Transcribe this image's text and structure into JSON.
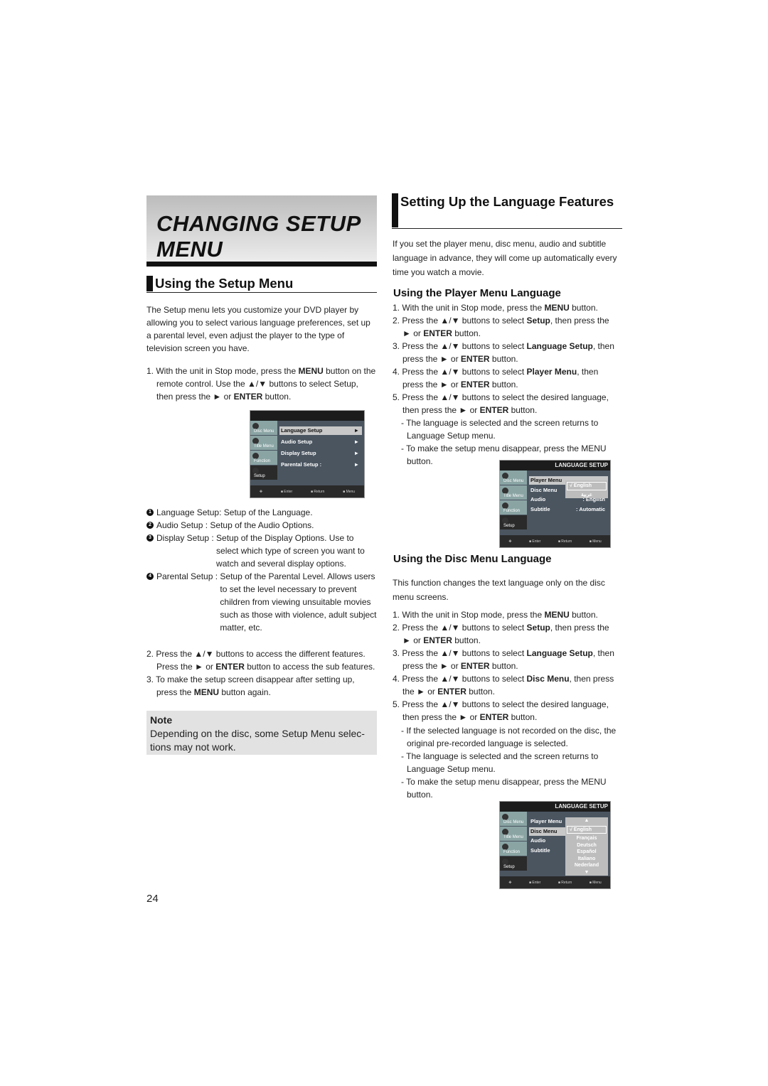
{
  "header": {
    "title_line1": "CHANGING SETUP",
    "title_line2": "MENU"
  },
  "left": {
    "heading": "Using the Setup Menu",
    "intro": "The Setup menu lets you customize your DVD player by allowing you to select various language preferences, set up a parental level, even adjust the player to the type of television screen you have.",
    "step1": [
      {
        "t": "1. With the unit in Stop mode, press the "
      },
      {
        "t": "MENU",
        "b": true
      },
      {
        "t": " button on the remote control.  Use the ▲/▼ buttons to select Setup, then press the ► or "
      },
      {
        "t": "ENTER",
        "b": true
      },
      {
        "t": " button."
      }
    ],
    "legend": [
      {
        "n": "1",
        "label": "Language Setup: Setup of the Language."
      },
      {
        "n": "2",
        "label": "Audio Setup : Setup of the Audio Options."
      },
      {
        "n": "3",
        "label": "Display Setup : Setup of the Display Options. Use to select which type of screen you want to watch and several display options."
      },
      {
        "n": "4",
        "label": "Parental Setup : Setup of the Parental Level. Allows users to set the level necessary to prevent children from viewing unsuitable movies such as those with violence, adult subject matter, etc."
      }
    ],
    "steps2": [
      [
        {
          "t": "2. Press the ▲/▼ buttons to access the different  features. Press the ► or "
        },
        {
          "t": "ENTER",
          "b": true
        },
        {
          "t": " button to access the sub features."
        }
      ],
      [
        {
          "t": "3. To make the setup screen disappear after setting up, press the "
        },
        {
          "t": "MENU",
          "b": true
        },
        {
          "t": " button again."
        }
      ]
    ],
    "note": {
      "title": "Note",
      "text": "Depending on the disc, some Setup Menu selec- tions may not work."
    }
  },
  "right": {
    "heading": "Setting Up the Language Features",
    "intro": "If you set the player menu, disc menu, audio and subtitle language in advance, they will come up automatically every time you watch a movie.",
    "player": {
      "title": "Using the Player Menu Language",
      "steps": [
        [
          {
            "t": "1. With the unit in Stop mode, press the "
          },
          {
            "t": "MENU",
            "b": true
          },
          {
            "t": " button."
          }
        ],
        [
          {
            "t": "2. Press the ▲/▼ buttons to select "
          },
          {
            "t": "Setup",
            "b": true
          },
          {
            "t": ", then press the ► or "
          },
          {
            "t": "ENTER",
            "b": true
          },
          {
            "t": " button."
          }
        ],
        [
          {
            "t": "3. Press the ▲/▼ buttons to select "
          },
          {
            "t": "Language Setup",
            "b": true
          },
          {
            "t": ", then press the ► or "
          },
          {
            "t": "ENTER",
            "b": true
          },
          {
            "t": " button."
          }
        ],
        [
          {
            "t": "4. Press the ▲/▼ buttons to select "
          },
          {
            "t": "Player Menu",
            "b": true
          },
          {
            "t": ", then press the ► or "
          },
          {
            "t": "ENTER",
            "b": true
          },
          {
            "t": " button."
          }
        ],
        [
          {
            "t": "5. Press the ▲/▼ buttons to select the desired language, then press the ► or "
          },
          {
            "t": "ENTER",
            "b": true
          },
          {
            "t": " button."
          }
        ]
      ],
      "notes": [
        "- The language is selected and the screen returns to Language Setup menu.",
        "- To make the setup menu disappear, press the MENU button."
      ]
    },
    "disc": {
      "title": "Using the Disc Menu Language",
      "intro": "This function changes the text language only on the disc menu screens.",
      "steps": [
        [
          {
            "t": "1. With the unit in Stop mode, press the "
          },
          {
            "t": "MENU",
            "b": true
          },
          {
            "t": " button."
          }
        ],
        [
          {
            "t": "2. Press the ▲/▼ buttons to select "
          },
          {
            "t": "Setup",
            "b": true
          },
          {
            "t": ", then press the ► or "
          },
          {
            "t": "ENTER",
            "b": true
          },
          {
            "t": " button."
          }
        ],
        [
          {
            "t": "3. Press the ▲/▼ buttons to select "
          },
          {
            "t": "Language Setup",
            "b": true
          },
          {
            "t": ", then press the ► or "
          },
          {
            "t": "ENTER",
            "b": true
          },
          {
            "t": " button."
          }
        ],
        [
          {
            "t": "4. Press the  ▲/▼ buttons to select "
          },
          {
            "t": "Disc Menu",
            "b": true
          },
          {
            "t": ", then press the ► or "
          },
          {
            "t": "ENTER",
            "b": true
          },
          {
            "t": "  button."
          }
        ],
        [
          {
            "t": "5. Press the ▲/▼ buttons to select the desired     language, then press the ► or "
          },
          {
            "t": "ENTER",
            "b": true
          },
          {
            "t": " button."
          }
        ]
      ],
      "notes": [
        "- If the selected language is not recorded on  the disc, the original pre-recorded language is selected.",
        "- The language is selected and the screen returns to Language Setup menu.",
        "- To make the setup menu disappear, press the MENU button."
      ]
    }
  },
  "screens": [
    {
      "title": "",
      "tabs": [
        "Disc Menu",
        "Title Menu",
        "Function",
        "Setup"
      ],
      "rows": [
        {
          "l": "Language Setup",
          "r": "►",
          "sel": true
        },
        {
          "l": "Audio Setup",
          "r": "►"
        },
        {
          "l": "Display Setup",
          "r": "►"
        },
        {
          "l": "Parental Setup :",
          "r": "►"
        }
      ],
      "footer": [
        "Enter",
        "Return",
        "Menu"
      ]
    },
    {
      "title": "LANGUAGE SETUP",
      "tabs": [
        "Disc Menu",
        "Title Menu",
        "Function",
        "Setup"
      ],
      "rows": [
        {
          "l": "Player Menu",
          "sel": true
        },
        {
          "l": "Disc Menu"
        },
        {
          "l": "Audio",
          "r": ": English"
        },
        {
          "l": "Subtitle",
          "r": ": Automatic"
        }
      ],
      "popup": [
        "√  English",
        "عربية"
      ],
      "footer": [
        "Enter",
        "Return",
        "Menu"
      ]
    },
    {
      "title": "LANGUAGE SETUP",
      "tabs": [
        "Disc Menu",
        "Title Menu",
        "Function",
        "Setup"
      ],
      "rows": [
        {
          "l": "Player Menu"
        },
        {
          "l": "Disc Menu",
          "sel": true
        },
        {
          "l": "Audio"
        },
        {
          "l": "Subtitle"
        }
      ],
      "popup": [
        "▲",
        "√ English",
        "Français",
        "Deutsch",
        "Español",
        "Italiano",
        "Nederland",
        "▼"
      ],
      "footer": [
        "Enter",
        "Return",
        "Menu"
      ]
    }
  ],
  "page_number": "24"
}
